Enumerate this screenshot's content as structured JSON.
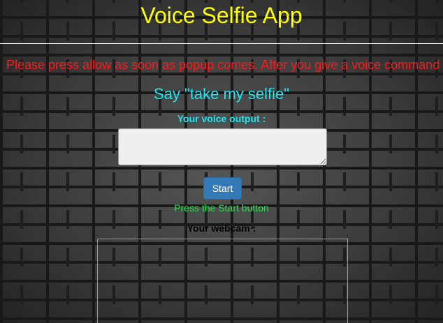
{
  "app": {
    "title": "Voice Selfie App"
  },
  "instruction_text": "Please press allow as soon as popup comes. After you give a voice command",
  "command_hint": "Say \"take my selfie\"",
  "voice_output": {
    "label": "Your voice output :",
    "value": "",
    "placeholder": ""
  },
  "start_button": {
    "label": "Start"
  },
  "status_text": "Press the Start button",
  "webcam": {
    "label": "Your webcam :"
  },
  "colors": {
    "title": "#ffff00",
    "instruction": "#ff1a1a",
    "command": "#22e5f0",
    "status": "#33dd55",
    "button_bg": "#337ab7"
  }
}
